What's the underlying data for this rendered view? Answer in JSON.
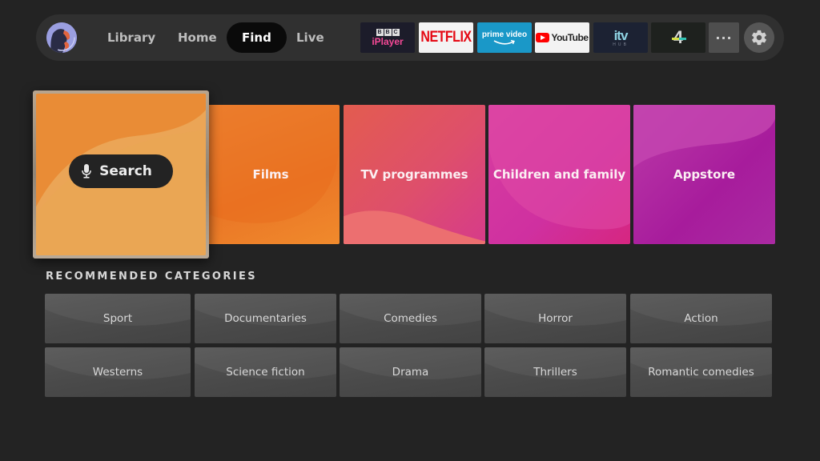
{
  "nav": {
    "profile": "avatar",
    "items": [
      {
        "label": "Library",
        "active": false
      },
      {
        "label": "Home",
        "active": false
      },
      {
        "label": "Find",
        "active": true
      },
      {
        "label": "Live",
        "active": false
      }
    ],
    "apps": {
      "bbc": {
        "letters": [
          "B",
          "B",
          "C"
        ],
        "name": "iPlayer"
      },
      "netflix": {
        "name": "NETFLIX"
      },
      "prime": {
        "name": "prime video"
      },
      "youtube": {
        "name": "YouTube"
      },
      "itv": {
        "name": "itv",
        "sub": "HUB"
      },
      "channel4": {
        "name": "4"
      }
    },
    "more_label": "···",
    "colors": {
      "active_bg": "#0a0a0a",
      "bar_bg": "#303030"
    }
  },
  "main_tiles": {
    "search": {
      "label": "Search",
      "icon": "microphone-icon"
    },
    "items": [
      {
        "label": "Films"
      },
      {
        "label": "TV programmes"
      },
      {
        "label": "Children and family"
      },
      {
        "label": "Appstore"
      }
    ]
  },
  "recommended": {
    "title": "RECOMMENDED CATEGORIES",
    "rows": [
      [
        "Sport",
        "Documentaries",
        "Comedies",
        "Horror",
        "Action"
      ],
      [
        "Westerns",
        "Science fiction",
        "Drama",
        "Thrillers",
        "Romantic comedies"
      ]
    ]
  }
}
